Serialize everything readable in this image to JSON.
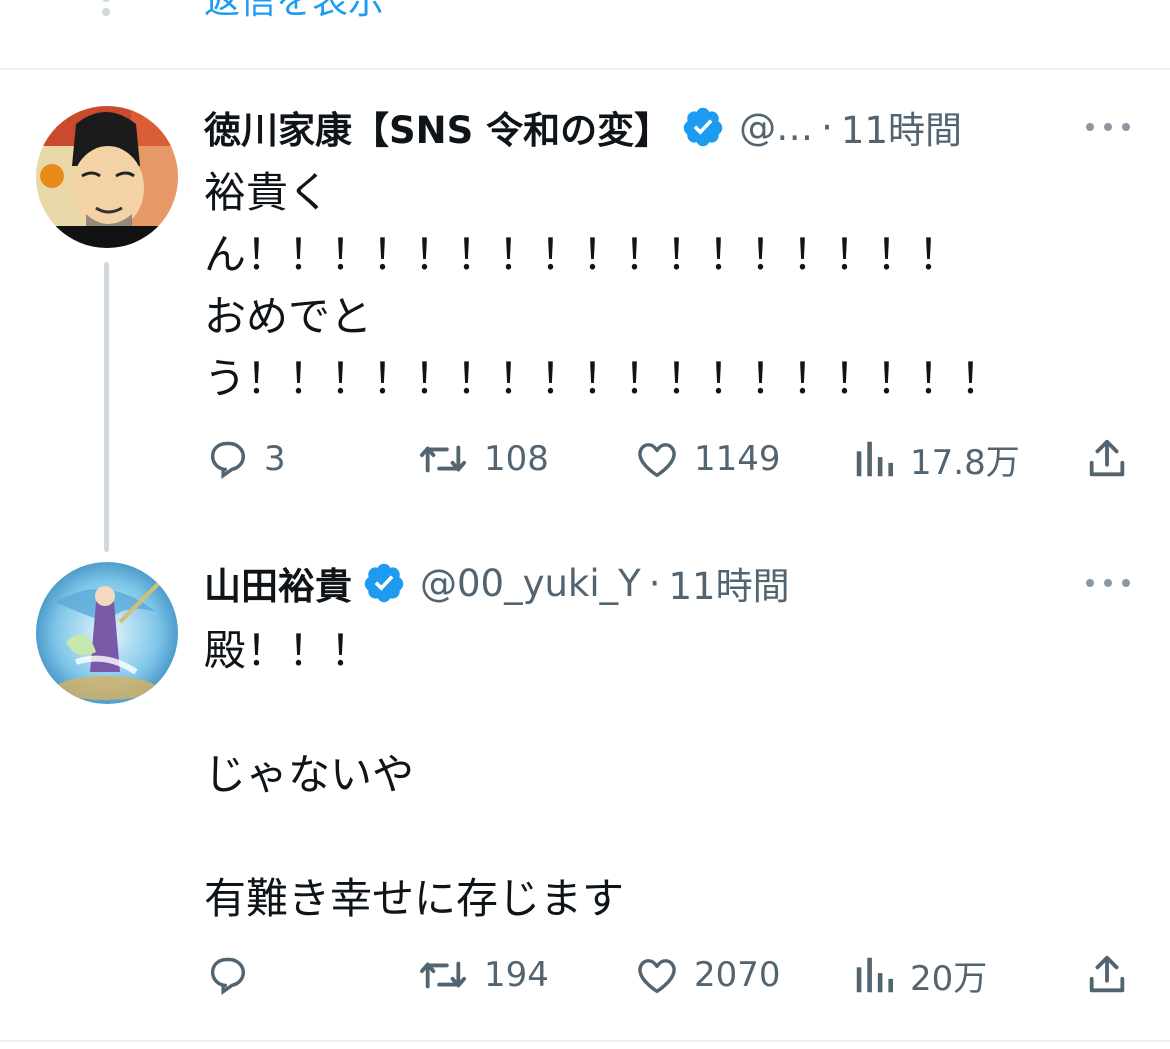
{
  "show_replies": {
    "label": "返信を表示"
  },
  "tweets": [
    {
      "display_name": "徳川家康【SNS 令和の変】",
      "verified": true,
      "handle": "@…",
      "separator": "·",
      "time": "11時間",
      "body_lines": [
        "裕貴く",
        "ん！！！！！！！！！！！！！！！！！",
        "おめでと",
        "う！！！！！！！！！！！！！！！！！！"
      ],
      "actions": {
        "reply": "3",
        "retweet": "108",
        "like": "1149",
        "views": "17.8万"
      }
    },
    {
      "display_name": "山田裕貴",
      "verified": true,
      "handle": "@00_yuki_Y",
      "separator": "·",
      "time": "11時間",
      "body_lines": [
        "殿！！！",
        "",
        "じゃないや",
        "",
        "有難き幸せに存じます"
      ],
      "actions": {
        "reply": "",
        "retweet": "194",
        "like": "2070",
        "views": "20万"
      }
    }
  ],
  "colors": {
    "link": "#1d9bf0",
    "verified": "#1d9bf0",
    "secondary_text": "#536471",
    "divider": "#eff3f4"
  },
  "icons": {
    "reply": "speech-bubble-icon",
    "retweet": "retweet-arrows-icon",
    "like": "heart-icon",
    "views": "bar-chart-icon",
    "share": "share-upload-icon",
    "more": "ellipsis-icon",
    "verified": "verified-badge-icon"
  }
}
